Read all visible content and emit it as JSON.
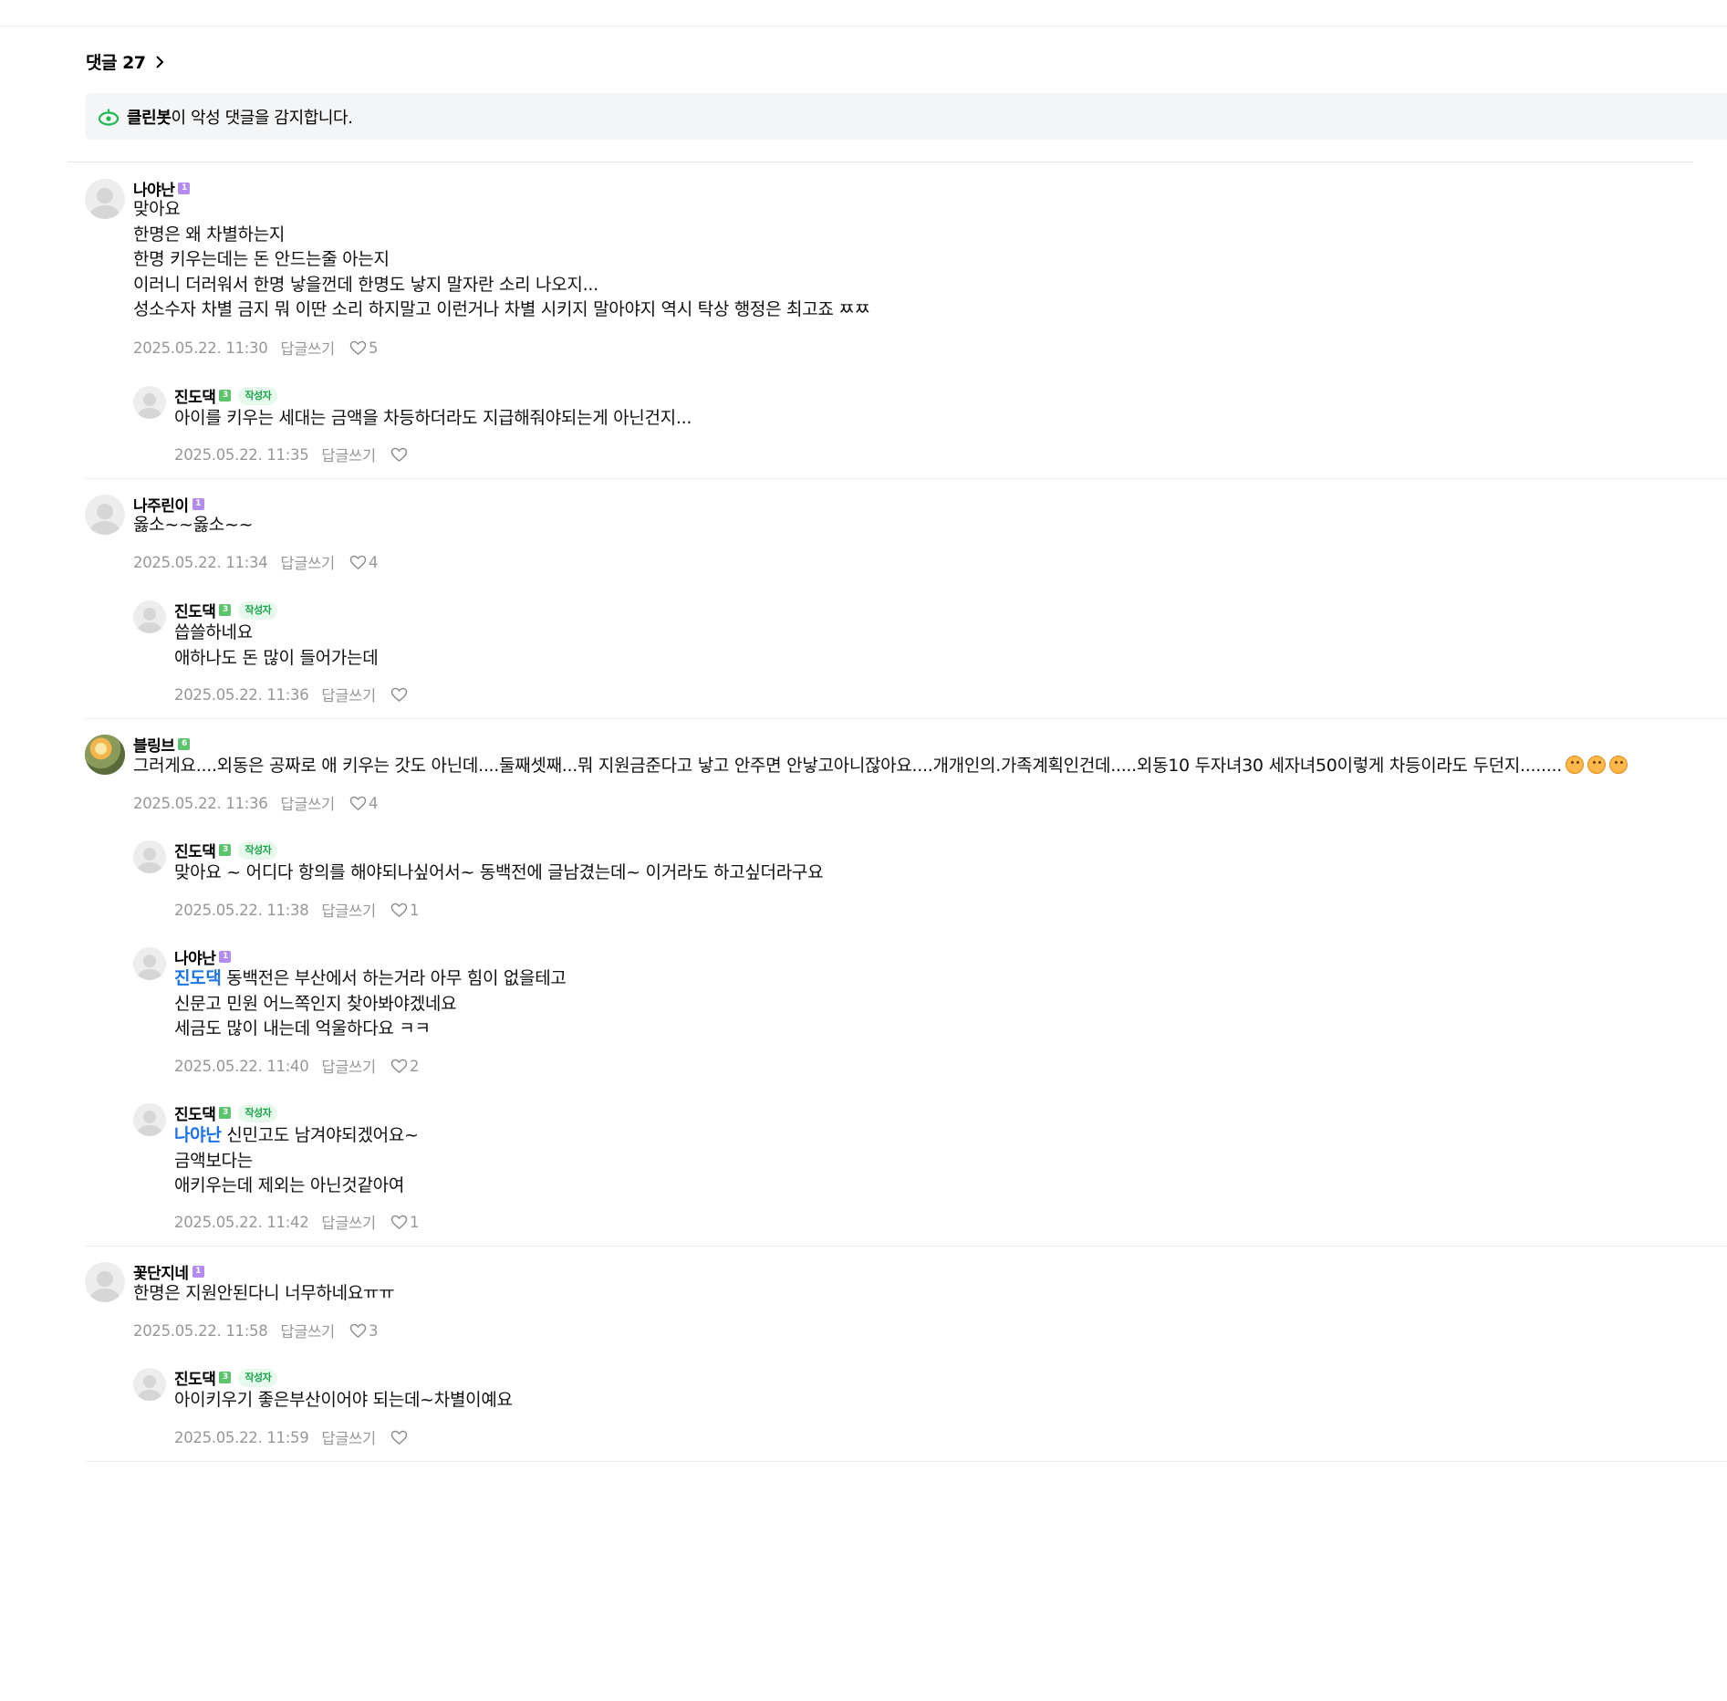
{
  "header": {
    "title": "댓글 27"
  },
  "cleanbot": {
    "name": "클린봇",
    "message": "이 악성 댓글을 감지합니다."
  },
  "reply_label": "답글쓰기",
  "comments": [
    {
      "nick": "나야난",
      "level": "1",
      "lines": [
        "맞아요",
        "한명은 왜 차별하는지",
        "한명 키우는데는 돈 안드는줄 아는지",
        "이러니 더러워서 한명 낳을껀데 한명도 낳지 말자란 소리 나오지...",
        "성소수자 차별 금지 뭐 이딴 소리 하지말고 이런거나 차별 시키지 말아야지 역시 탁상 행정은 최고죠 ㅉㅉ"
      ],
      "date": "2025.05.22. 11:30",
      "likes": "5"
    },
    {
      "nick": "진도댁",
      "level": "3",
      "badge": "작성자",
      "lines": [
        "아이를 키우는 세대는 금액을 차등하더라도 지급해줘야되는게 아닌건지..."
      ],
      "date": "2025.05.22. 11:35",
      "likes": ""
    },
    {
      "nick": "나주린이",
      "level": "1",
      "lines": [
        "옳소~~옳소~~"
      ],
      "date": "2025.05.22. 11:34",
      "likes": "4"
    },
    {
      "nick": "진도댁",
      "level": "3",
      "badge": "작성자",
      "lines": [
        "씁쓸하네요",
        "애하나도 돈 많이 들어가는데"
      ],
      "date": "2025.05.22. 11:36",
      "likes": ""
    },
    {
      "nick": "블링브",
      "level": "6",
      "lines": [
        "그러게요....외동은 공짜로 애 키우는 갓도 아닌데....둘째셋째...뭐 지원금준다고 낳고 안주면 안낳고아니잖아요....개개인의.가족계획인건데.....외동10 두자녀30 세자녀50이렇게 차등이라도 두던지........"
      ],
      "date": "2025.05.22. 11:36",
      "likes": "4"
    },
    {
      "nick": "진도댁",
      "level": "3",
      "badge": "작성자",
      "lines": [
        "맞아요 ~ 어디다 항의를 해야되나싶어서~ 동백전에 글남겼는데~ 이거라도 하고싶더라구요"
      ],
      "date": "2025.05.22. 11:38",
      "likes": "1"
    },
    {
      "nick": "나야난",
      "level": "1",
      "mention": "진도댁",
      "lines": [
        "동백전은 부산에서 하는거라 아무 힘이 없을테고",
        "신문고 민원 어느쪽인지 찾아봐야겠네요",
        "세금도 많이 내는데 억울하다요 ㅋㅋ"
      ],
      "date": "2025.05.22. 11:40",
      "likes": "2"
    },
    {
      "nick": "진도댁",
      "level": "3",
      "badge": "작성자",
      "mention": "나야난",
      "lines": [
        "신민고도 남겨야되겠어요~",
        "금액보다는",
        "애키우는데 제외는 아닌것같아여"
      ],
      "date": "2025.05.22. 11:42",
      "likes": "1"
    },
    {
      "nick": "꽃단지네",
      "level": "1",
      "lines": [
        "한명은 지원안된다니 너무하네요ㅠㅠ"
      ],
      "date": "2025.05.22. 11:58",
      "likes": "3"
    },
    {
      "nick": "진도댁",
      "level": "3",
      "badge": "작성자",
      "lines": [
        "아이키우기 좋은부산이어야 되는데~차별이예요"
      ],
      "date": "2025.05.22. 11:59",
      "likes": ""
    }
  ]
}
